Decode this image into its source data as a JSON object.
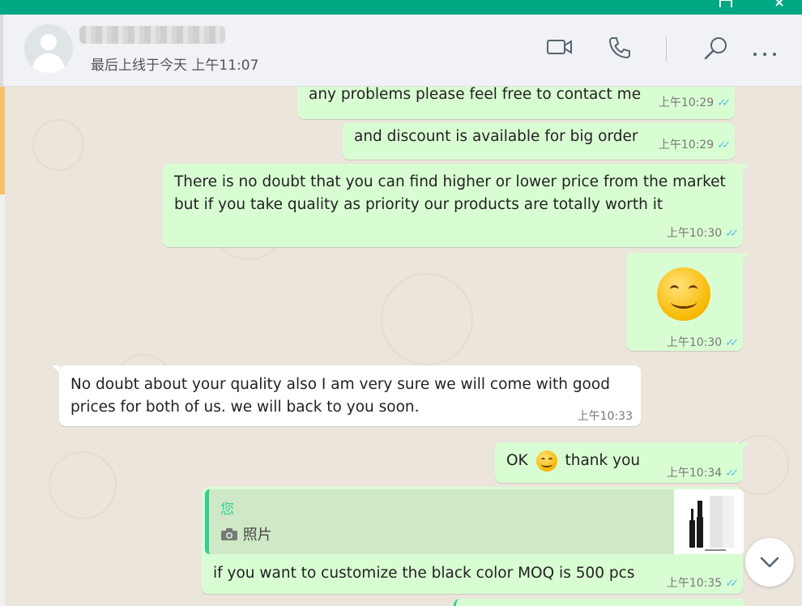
{
  "header": {
    "last_seen": "最后上线于今天 上午11:07"
  },
  "messages": [
    {
      "text": "any problems please feel free to contact me",
      "time": "上午10:29",
      "status": "read"
    },
    {
      "text": "and discount is available for big order",
      "time": "上午10:29",
      "status": "read"
    },
    {
      "lines": [
        "There is no doubt that you can find higher or lower price from the market",
        "but if you take quality as priority our products are totally worth it"
      ],
      "time": "上午10:30",
      "status": "read"
    },
    {
      "emoji": "smiling-face-emoji",
      "time": "上午10:30",
      "status": "read"
    },
    {
      "lines": [
        "No doubt about your quality also I am very sure we will come with good",
        "prices for both of us. we will back to you soon."
      ],
      "time": "上午10:33",
      "direction": "incoming"
    },
    {
      "text_before": "OK",
      "text_after": "thank you",
      "time": "上午10:34",
      "status": "read"
    },
    {
      "quote": {
        "author": "您",
        "type_label": "照片"
      },
      "text": "if you want to customize the black color MOQ is 500 pcs",
      "time": "上午10:35",
      "status": "read"
    }
  ],
  "icons": {
    "video": "video-call-icon",
    "voice": "voice-call-icon",
    "search": "search-icon",
    "menu": "more-options-icon",
    "scroll": "chevron-down-icon"
  },
  "colors": {
    "accent": "#00a884",
    "outgoing_bubble": "#d9fdd3",
    "incoming_bubble": "#ffffff",
    "read_ticks": "#53bdeb",
    "chat_background": "#ebe5dc"
  }
}
